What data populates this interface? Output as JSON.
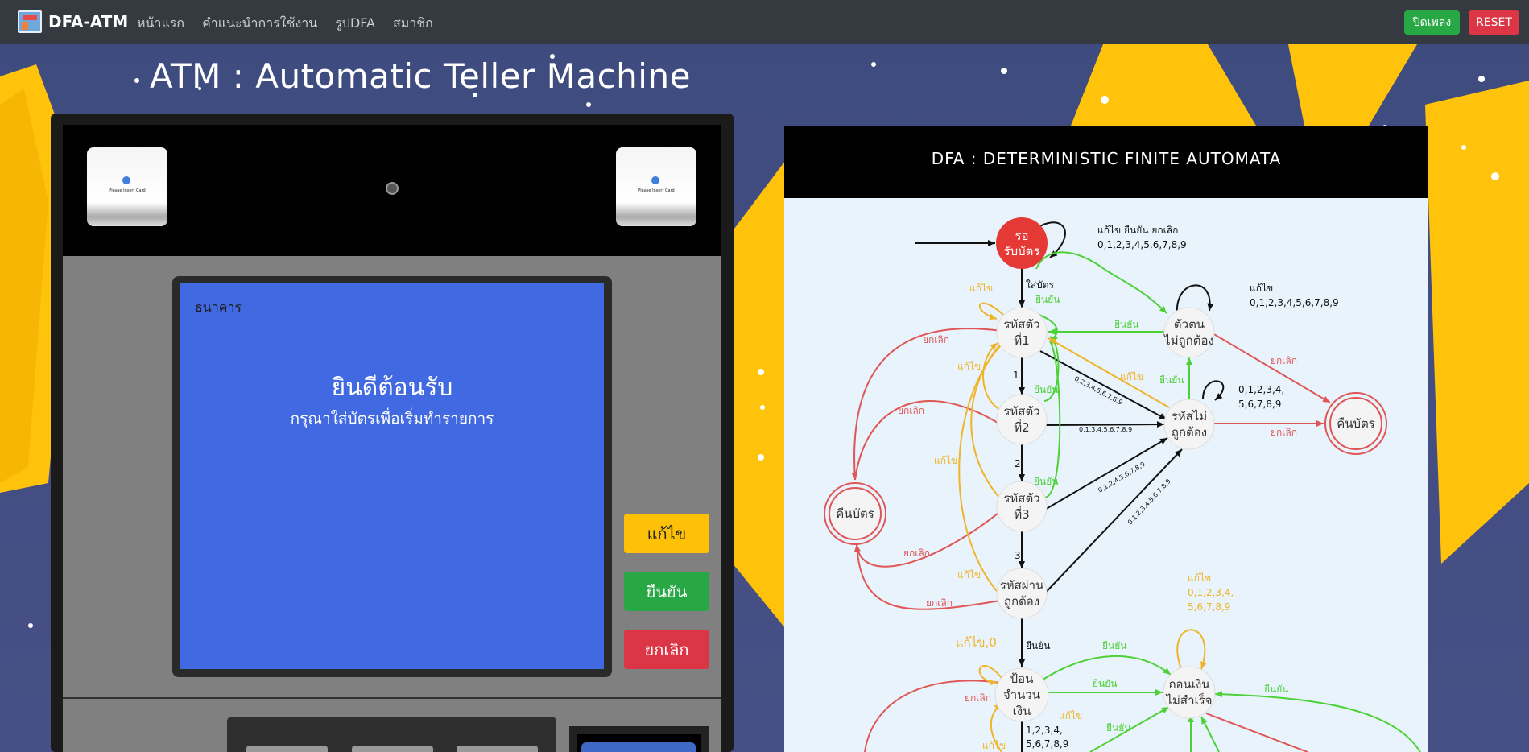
{
  "app": {
    "brand": "DFA-ATM"
  },
  "nav": {
    "items": [
      "หน้าแรก",
      "คำแนะนำการใช้งาน",
      "รูปDFA",
      "สมาชิก"
    ],
    "music_button": "ปิดเพลง",
    "reset_button": "RESET"
  },
  "page": {
    "title": "ATM : Automatic Teller Machine"
  },
  "atm": {
    "card_label": "Please Insert Card",
    "bank_label": "ธนาคาร",
    "welcome": "ยินดีต้อนรับ",
    "instruction": "กรุณาใส่บัตรเพื่อเริ่มทำรายการ",
    "buttons": {
      "edit": "แก้ไข",
      "confirm": "ยืนยัน",
      "cancel": "ยกเลิก"
    }
  },
  "dfa": {
    "title": "DFA : DETERMINISTIC FINITE AUTOMATA",
    "states": {
      "wait": "รอ|รับบัตร",
      "d1": "รหัสตัว|ที่1",
      "d2": "รหัสตัว|ที่2",
      "d3": "รหัสตัว|ที่3",
      "ok": "รหัสผ่าน|ถูกต้อง",
      "wrongchar": "ตัวตน|ไม่ถูกต้อง",
      "wrongpin": "รหัสไม่|ถูกต้อง",
      "eject1": "คืนบัตร",
      "eject2": "คืนบัตร",
      "amount": "ป้อน|จำนวน|เงิน",
      "fail": "ถอนเงิน|ไม่สำเร็จ"
    },
    "labels": {
      "self_wait_a": "แก้ไข ยืนยัน ยกเลิก",
      "self_wait_b": "0,1,2,3,4,5,6,7,8,9",
      "insert": "ใส่บัตร",
      "edit": "แก้ไข",
      "confirm": "ยืนยัน",
      "cancel": "ยกเลิก",
      "one": "1",
      "two": "2",
      "three": "3",
      "self_wc_a": "แก้ไข",
      "self_wc_b": "0,1,2,3,4,5,6,7,8,9",
      "self_wp_a": "0,1,2,3,4,",
      "self_wp_b": "5,6,7,8,9",
      "d1_to_wp": "0,2,3,4,5,6,7,8,9",
      "d2_to_wp": "0,1,3,4,5,6,7,8,9",
      "d3_to_wp": "0,1,2,4,5,6,7,8,9",
      "ok_to_wp": "0,1,2,3,4,5,6,7,8,9",
      "edit0": "แก้ไข,0",
      "digits_a": "1,2,3,4,",
      "digits_b": "5,6,7,8,9",
      "fail_self_a": "แก้ไข",
      "fail_self_b": "0,1,2,3,4,",
      "fail_self_c": "5,6,7,8,9"
    }
  }
}
